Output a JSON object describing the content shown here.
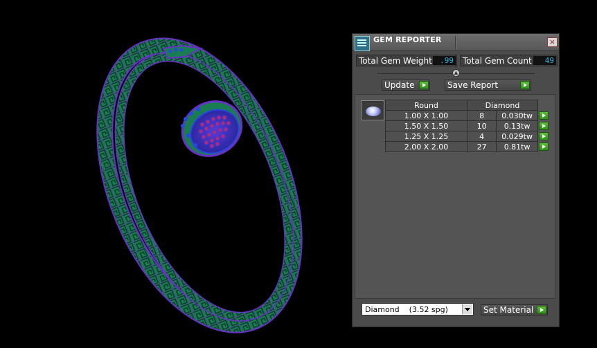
{
  "window": {
    "title": "GEM REPORTER",
    "close_glyph": "×"
  },
  "stats": {
    "total_weight_label": "Total Gem Weight",
    "total_weight_value": ".99",
    "total_count_label": "Total Gem Count",
    "total_count_value": "49"
  },
  "buttons": {
    "update": "Update",
    "save_report": "Save Report",
    "set_material": "Set Material"
  },
  "table": {
    "headers": [
      "Round",
      "",
      "Diamond"
    ],
    "rows": [
      {
        "size": "1.00 X 1.00",
        "count": "8",
        "weight": "0.030tw"
      },
      {
        "size": "1.50 X 1.50",
        "count": "10",
        "weight": "0.13tw"
      },
      {
        "size": "1.25 X 1.25",
        "count": "4",
        "weight": "0.029tw"
      },
      {
        "size": "2.00 X 2.00",
        "count": "27",
        "weight": "0.81tw"
      }
    ]
  },
  "material": {
    "selected": "Diamond    (3.52 spg)"
  },
  "colors": {
    "accent_green": "#3aa51f",
    "value_blue": "#37b3e0",
    "panel_bg": "#4b4b4b",
    "bracelet_green": "#1f8a5a",
    "bracelet_purple": "#7a2fd0"
  },
  "icons": {
    "app": "gem-reporter-app-icon",
    "gem": "round-diamond-gem-icon",
    "go": "green-play-arrow-icon"
  }
}
